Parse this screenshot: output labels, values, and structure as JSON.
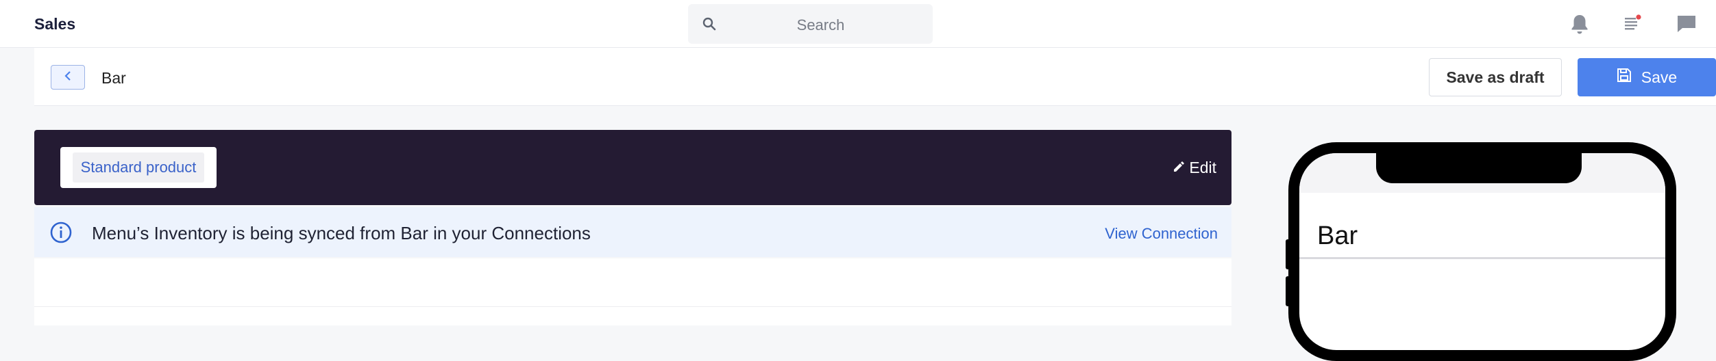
{
  "app": {
    "title": "Sales"
  },
  "search": {
    "placeholder": "Search"
  },
  "topbar": {
    "icons": [
      "bell-icon",
      "tasks-icon",
      "chat-icon"
    ],
    "tasks_badge_color": "#e5484d"
  },
  "header": {
    "title": "Bar",
    "save_draft_label": "Save as draft",
    "save_label": "Save"
  },
  "product": {
    "type_label": "Standard product",
    "edit_label": "Edit"
  },
  "banner": {
    "message": "Menu’s Inventory is being synced from Bar in your Connections",
    "link_label": "View Connection"
  },
  "preview": {
    "title": "Bar"
  },
  "colors": {
    "accent": "#4d82ec",
    "hero_bg": "#241b33",
    "banner_bg": "#edf3fd",
    "link": "#2f63cf"
  }
}
